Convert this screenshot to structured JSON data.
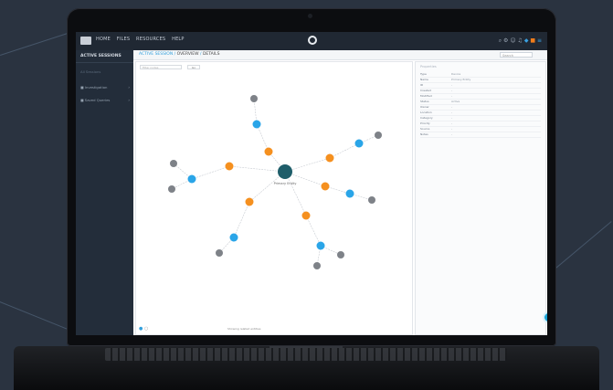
{
  "app": {
    "menu": [
      "HOME",
      "FILES",
      "RESOURCES",
      "HELP"
    ],
    "top_icons": [
      "search-icon",
      "settings-icon",
      "user-icon",
      "notifications-icon",
      "bookmark-icon",
      "alert-icon"
    ]
  },
  "sidebar": {
    "title": "ACTIVE SESSIONS",
    "items": [
      {
        "label": "All Sessions"
      },
      {
        "label": "Investigation"
      },
      {
        "label": "Saved Queries"
      }
    ]
  },
  "breadcrumb": {
    "root": "ACTIVE SESSION",
    "middle": "OVERVIEW",
    "current": "DETAILS"
  },
  "search": {
    "placeholder": "Search"
  },
  "graph": {
    "filter_placeholder": "Filter nodes",
    "button_label": "Go",
    "bottom_label": "Showing related entities",
    "center_label": "Primary Entity",
    "colors": {
      "center": "#1f5e6a",
      "orange": "#f5901f",
      "blue": "#2aa5e8",
      "gray": "#7e8288"
    }
  },
  "details": {
    "heading": "Properties",
    "rows": [
      {
        "key": "Type",
        "value": "Device"
      },
      {
        "key": "Name",
        "value": "Primary Entity"
      },
      {
        "key": "ID",
        "value": "-"
      },
      {
        "key": "Created",
        "value": "-"
      },
      {
        "key": "Modified",
        "value": "-"
      },
      {
        "key": "Status",
        "value": "Active"
      },
      {
        "key": "Owner",
        "value": "-"
      },
      {
        "key": "Location",
        "value": "-"
      },
      {
        "key": "Category",
        "value": "-"
      },
      {
        "key": "Priority",
        "value": "-"
      },
      {
        "key": "Source",
        "value": "-"
      },
      {
        "key": "Notes",
        "value": "-"
      }
    ]
  }
}
